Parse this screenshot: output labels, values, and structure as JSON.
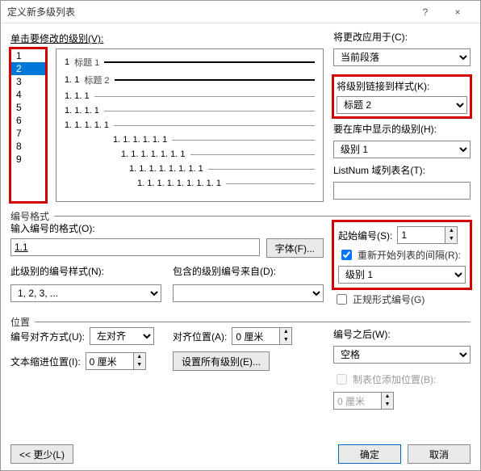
{
  "title": "定义新多级列表",
  "help_icon": "?",
  "close_icon": "×",
  "labels": {
    "click_level": "单击要修改的级别(V):",
    "apply_to": "将更改应用于(C):",
    "link_style": "将级别链接到样式(K):",
    "show_in_gallery": "要在库中显示的级别(H):",
    "listnum": "ListNum 域列表名(T):",
    "number_format_section": "编号格式",
    "enter_format": "输入编号的格式(O):",
    "font_btn": "字体(F)...",
    "style_for_level": "此级别的编号样式(N):",
    "include_from": "包含的级别编号来自(D):",
    "start_at": "起始编号(S):",
    "restart_after": "重新开始列表的间隔(R):",
    "legal": "正规形式编号(G)",
    "position_section": "位置",
    "align": "编号对齐方式(U):",
    "align_at": "对齐位置(A):",
    "indent_at": "文本缩进位置(I):",
    "set_all": "设置所有级别(E)...",
    "follow": "编号之后(W):",
    "add_tab": "制表位添加位置(B):",
    "less": "<< 更少(L)",
    "ok": "确定",
    "cancel": "取消"
  },
  "values": {
    "apply_to": "当前段落",
    "link_style": "标题 2",
    "show_in_gallery": "级别 1",
    "listnum": "",
    "enter_format": "1.1",
    "style_for_level": "1, 2, 3, ...",
    "include_from": "",
    "start_at": "1",
    "restart_after_checked": true,
    "restart_after": "级别 1",
    "legal_checked": false,
    "align": "左对齐",
    "align_at": "0 厘米",
    "indent_at": "0 厘米",
    "follow": "空格",
    "add_tab_checked": false,
    "add_tab": "0 厘米"
  },
  "levels": [
    "1",
    "2",
    "3",
    "4",
    "5",
    "6",
    "7",
    "8",
    "9"
  ],
  "selected_level_index": 1,
  "preview": [
    {
      "num": "1",
      "label": "标题 1",
      "bold": true,
      "indent": 0
    },
    {
      "num": "1. 1",
      "label": "标题 2",
      "bold": true,
      "indent": 0
    },
    {
      "num": "1. 1. 1",
      "label": "",
      "bold": false,
      "indent": 0
    },
    {
      "num": "1. 1. 1. 1",
      "label": "",
      "bold": false,
      "indent": 0
    },
    {
      "num": "1. 1. 1. 1. 1",
      "label": "",
      "bold": false,
      "indent": 0
    },
    {
      "num": "1. 1. 1. 1. 1. 1",
      "label": "",
      "bold": false,
      "indent": 60
    },
    {
      "num": "1. 1. 1. 1. 1. 1. 1",
      "label": "",
      "bold": false,
      "indent": 70
    },
    {
      "num": "1. 1. 1. 1. 1. 1. 1. 1",
      "label": "",
      "bold": false,
      "indent": 80
    },
    {
      "num": "1. 1. 1. 1. 1. 1. 1. 1. 1",
      "label": "",
      "bold": false,
      "indent": 90
    }
  ]
}
